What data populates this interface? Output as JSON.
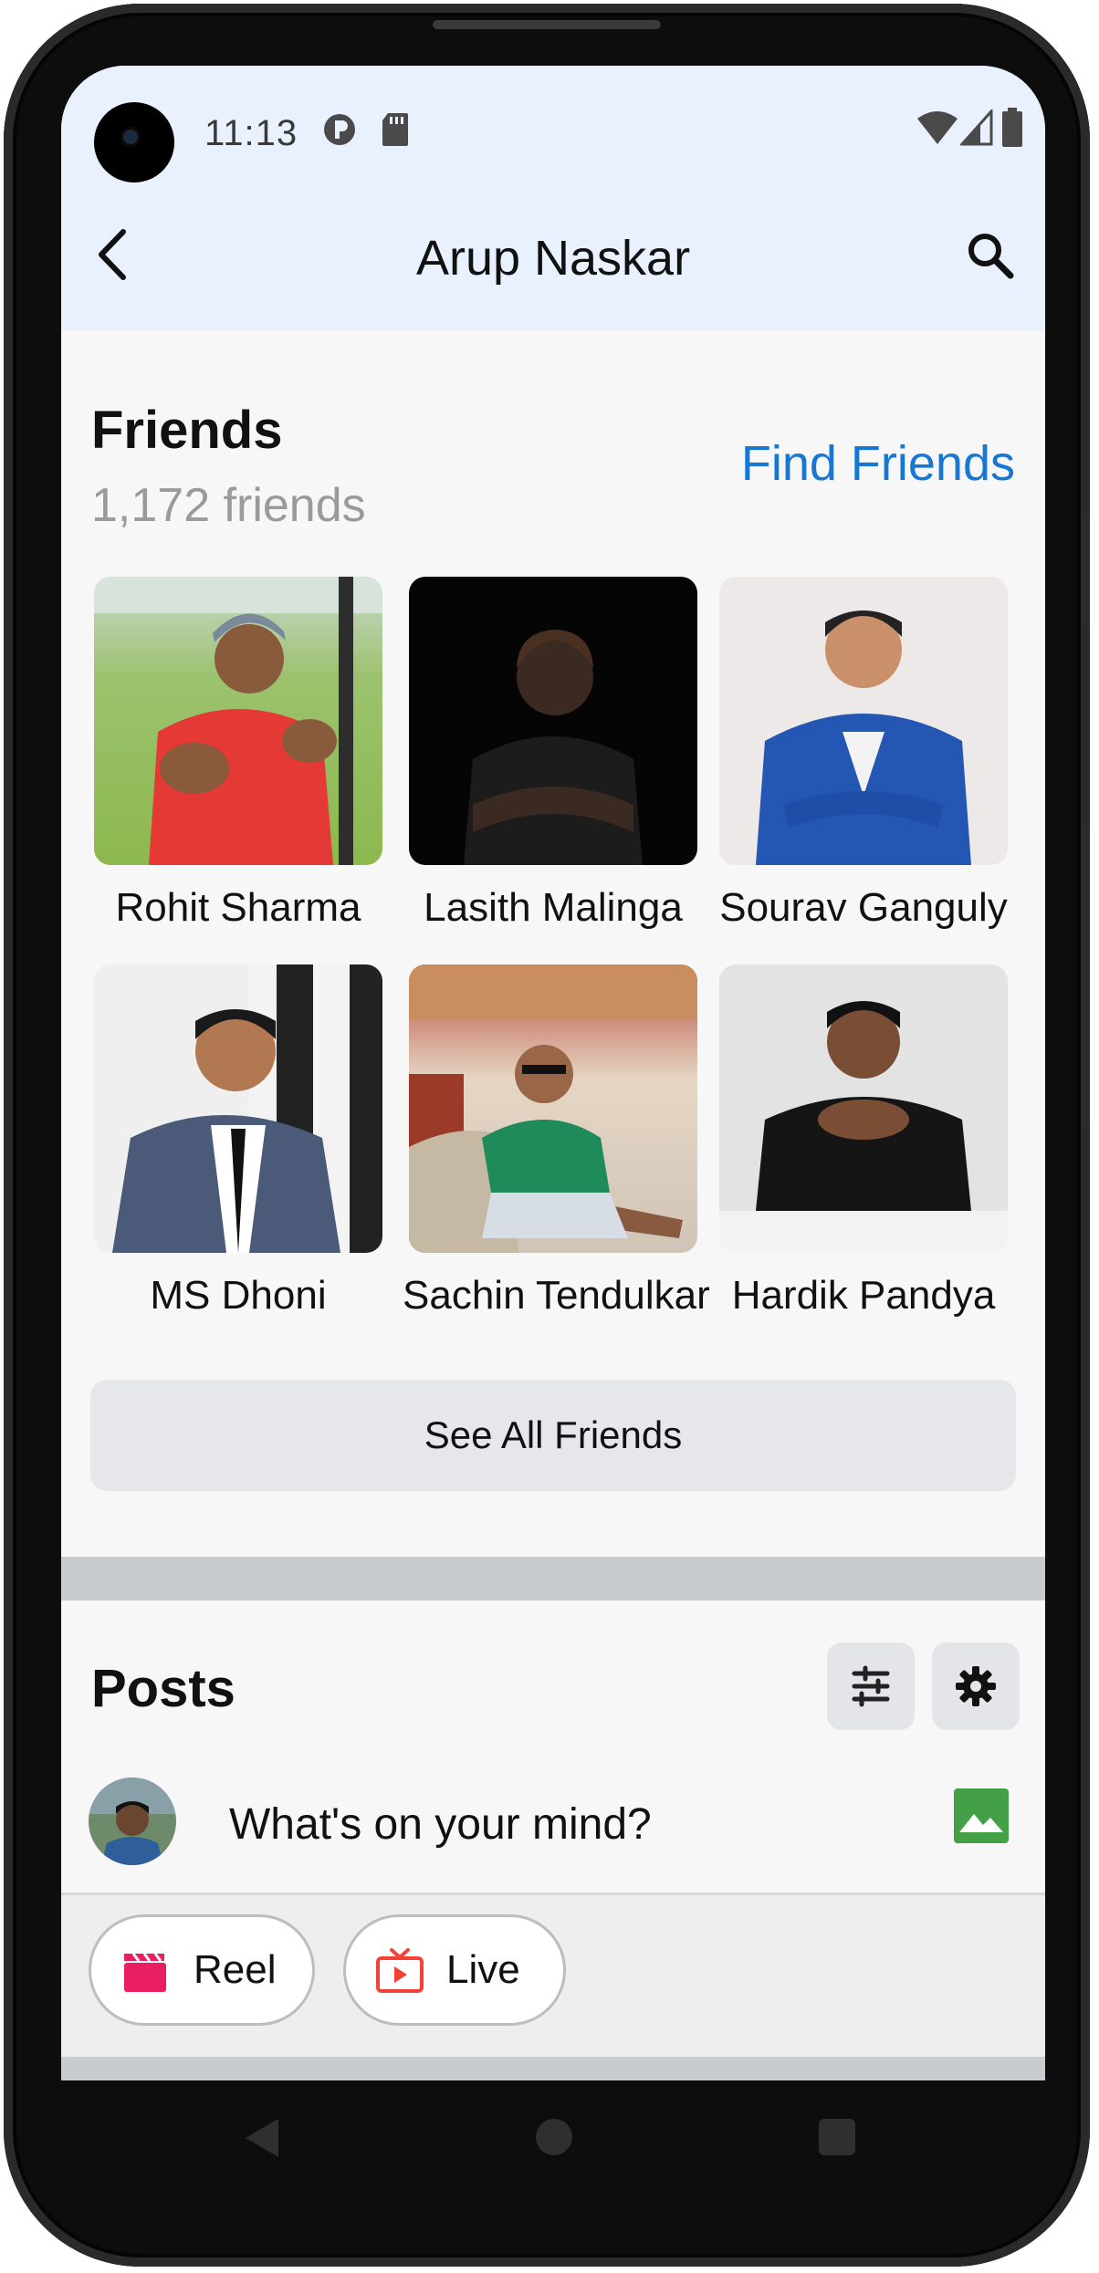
{
  "status_bar": {
    "time": "11:13",
    "icons": [
      "notification-p-icon",
      "sd-card-icon",
      "wifi-icon",
      "signal-icon",
      "battery-icon"
    ]
  },
  "app_bar": {
    "title": "Arup Naskar",
    "back_icon": "back-arrow-icon",
    "search_icon": "search-icon"
  },
  "friends": {
    "title": "Friends",
    "count": "1,172 friends",
    "find_friends": "Find Friends",
    "items": [
      {
        "name": "Rohit Sharma"
      },
      {
        "name": "Lasith Malinga"
      },
      {
        "name": "Sourav Ganguly"
      },
      {
        "name": "MS Dhoni"
      },
      {
        "name": "Sachin Tendulkar"
      },
      {
        "name": "Hardik Pandya"
      }
    ],
    "see_all": "See All Friends"
  },
  "posts": {
    "title": "Posts",
    "filter_icon": "filter-sliders-icon",
    "settings_icon": "gear-icon",
    "composer_placeholder": "What's on your mind?",
    "photo_icon": "photo-icon",
    "actions": [
      {
        "label": "Reel",
        "icon": "clapperboard-icon",
        "color": "#e91e63"
      },
      {
        "label": "Live",
        "icon": "live-tv-icon",
        "color": "#f44336"
      }
    ]
  },
  "colors": {
    "accent": "#1877d2",
    "top_bar": "#e8f1fd"
  }
}
